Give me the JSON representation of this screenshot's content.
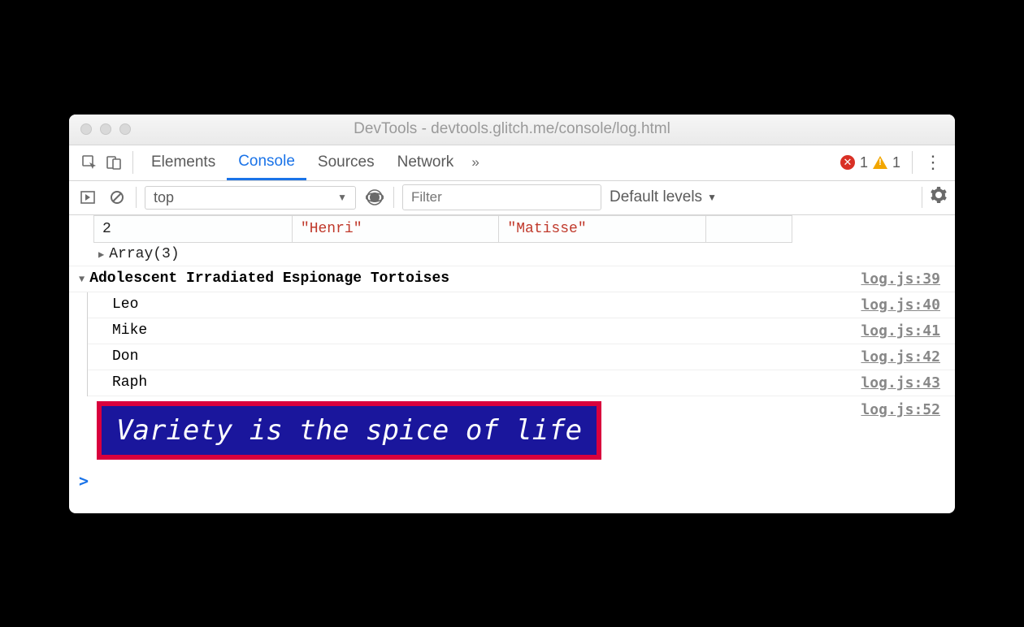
{
  "window": {
    "title": "DevTools - devtools.glitch.me/console/log.html"
  },
  "tabs": {
    "items": [
      "Elements",
      "Console",
      "Sources",
      "Network"
    ],
    "active_index": 1,
    "overflow_glyph": "»"
  },
  "counters": {
    "errors": "1",
    "warnings": "1"
  },
  "toolbar": {
    "context": "top",
    "dropdown_glyph": "▼",
    "filter_placeholder": "Filter",
    "levels_label": "Default levels"
  },
  "table": {
    "row_index": "2",
    "cells": [
      "\"Henri\"",
      "\"Matisse\""
    ]
  },
  "array_summary": "Array(3)",
  "group": {
    "title": "Adolescent Irradiated Espionage Tortoises",
    "src": "log.js:39",
    "items": [
      {
        "text": "Leo",
        "src": "log.js:40"
      },
      {
        "text": "Mike",
        "src": "log.js:41"
      },
      {
        "text": "Don",
        "src": "log.js:42"
      },
      {
        "text": "Raph",
        "src": "log.js:43"
      }
    ]
  },
  "styled": {
    "text": "Variety is the spice of life",
    "src": "log.js:52",
    "colors": {
      "bg": "#1a169c",
      "border": "#d9003d",
      "fg": "#ffffff"
    }
  },
  "prompt_glyph": ">"
}
